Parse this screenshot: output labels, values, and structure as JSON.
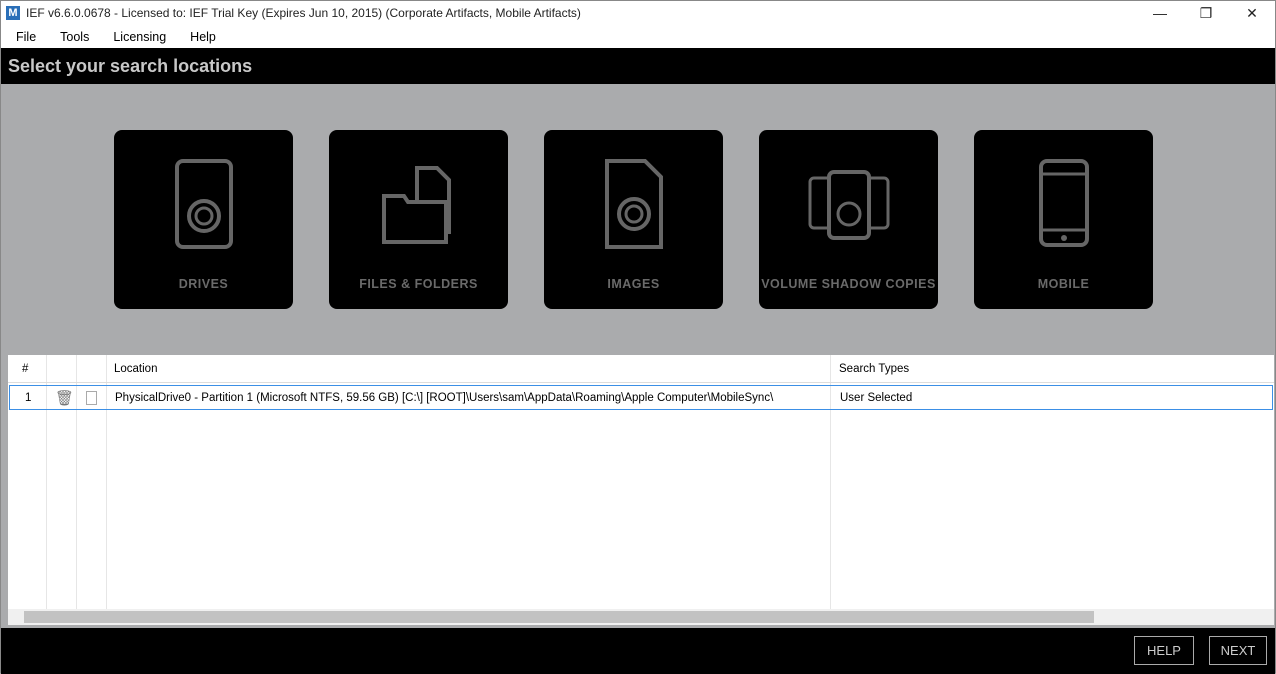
{
  "window": {
    "title": "IEF v6.6.0.0678 - Licensed to: IEF Trial Key (Expires Jun 10, 2015) (Corporate Artifacts, Mobile Artifacts)",
    "logo": "M"
  },
  "menu": [
    "File",
    "Tools",
    "Licensing",
    "Help"
  ],
  "header": "Select your search locations",
  "tiles": [
    "DRIVES",
    "FILES & FOLDERS",
    "IMAGES",
    "VOLUME SHADOW COPIES",
    "MOBILE"
  ],
  "table": {
    "columns": {
      "num": "#",
      "location": "Location",
      "search_types": "Search Types"
    },
    "rows": [
      {
        "num": "1",
        "location": "PhysicalDrive0 - Partition 1 (Microsoft NTFS, 59.56 GB)  [C:\\] [ROOT]\\Users\\sam\\AppData\\Roaming\\Apple Computer\\MobileSync\\",
        "search_types": "User Selected"
      }
    ]
  },
  "buttons": {
    "help": "HELP",
    "next": "NEXT"
  }
}
